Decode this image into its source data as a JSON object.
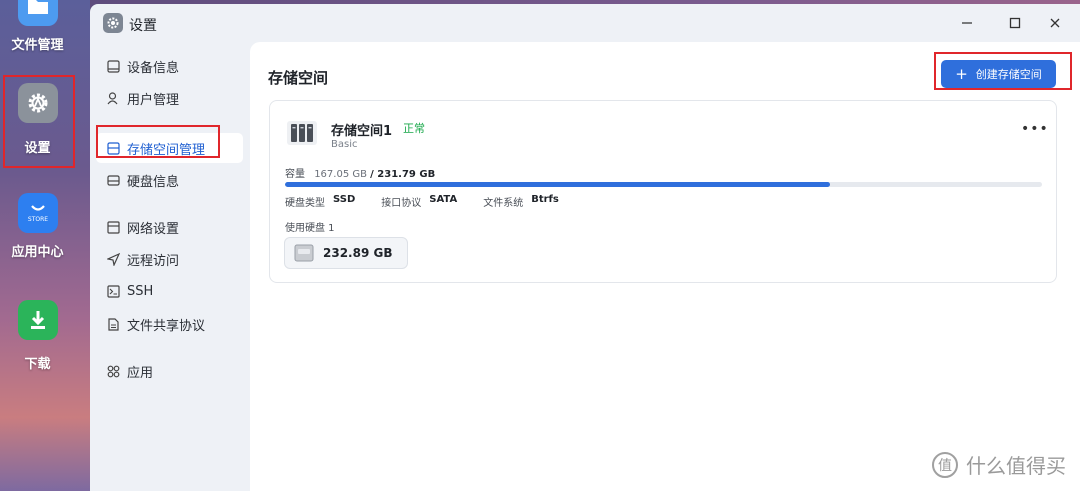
{
  "desktop": {
    "apps": [
      {
        "label": "文件管理",
        "icon": "folder-icon"
      },
      {
        "label": "设置",
        "icon": "settings-gear-icon"
      },
      {
        "label": "应用中心",
        "icon": "store-bag-icon",
        "icon_text": "STORE"
      },
      {
        "label": "下载",
        "icon": "download-icon"
      }
    ]
  },
  "window": {
    "title": "设置",
    "controls": [
      "minimize-icon",
      "maximize-icon",
      "close-icon"
    ]
  },
  "sidebar": {
    "items": [
      {
        "label": "设备信息",
        "icon": "device-info-icon"
      },
      {
        "label": "用户管理",
        "icon": "user-icon"
      },
      {
        "label": "存储空间管理",
        "icon": "storage-icon",
        "active": true
      },
      {
        "label": "硬盘信息",
        "icon": "disk-icon"
      },
      {
        "label": "网络设置",
        "icon": "network-icon"
      },
      {
        "label": "远程访问",
        "icon": "send-arrow-icon"
      },
      {
        "label": "SSH",
        "icon": "terminal-icon"
      },
      {
        "label": "文件共享协议",
        "icon": "file-share-icon"
      },
      {
        "label": "应用",
        "icon": "apps-icon"
      }
    ]
  },
  "main": {
    "title": "存储空间",
    "create_button": "创建存储空间",
    "pool": {
      "name": "存储空间1",
      "status": "正常",
      "type": "Basic",
      "more": "•••",
      "capacity_label": "容量",
      "used": "167.05 GB",
      "total": "/ 231.79 GB",
      "usage_fraction": 0.72,
      "disk_type_label": "硬盘类型",
      "disk_type": "SSD",
      "interface_label": "接口协议",
      "interface": "SATA",
      "fs_label": "文件系统",
      "fs": "Btrfs",
      "used_disks_label": "使用硬盘 1",
      "disk_size": "232.89 GB"
    }
  },
  "watermark": {
    "text": "什么值得买",
    "logo": "值"
  },
  "colors": {
    "accent": "#2f6fdc",
    "status_ok": "#19a84a",
    "highlight": "#e0262b"
  }
}
